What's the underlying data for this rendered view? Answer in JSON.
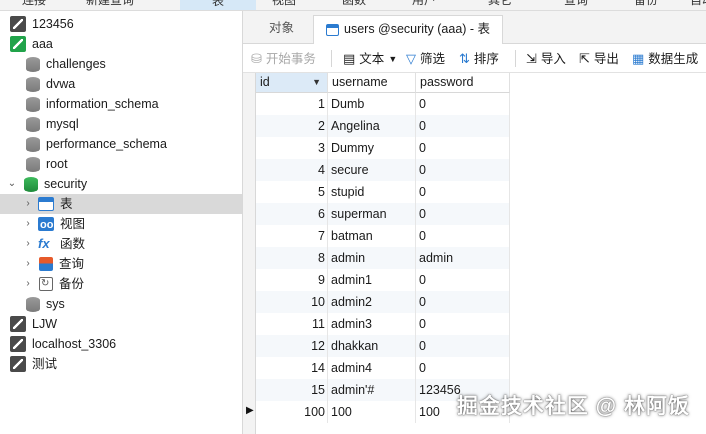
{
  "menu": {
    "items": [
      "连接",
      "新建查询",
      "表",
      "视图",
      "函数",
      "用户",
      "其它",
      "查询",
      "备份",
      "自动"
    ]
  },
  "sidebar": {
    "nodes": [
      {
        "label": "123456",
        "kind": "connection"
      },
      {
        "label": "aaa",
        "kind": "connection-open"
      },
      {
        "label": "challenges",
        "kind": "database"
      },
      {
        "label": "dvwa",
        "kind": "database"
      },
      {
        "label": "information_schema",
        "kind": "database"
      },
      {
        "label": "mysql",
        "kind": "database"
      },
      {
        "label": "performance_schema",
        "kind": "database"
      },
      {
        "label": "root",
        "kind": "database"
      },
      {
        "label": "security",
        "kind": "database-open"
      },
      {
        "label": "表",
        "kind": "tables"
      },
      {
        "label": "视图",
        "kind": "views"
      },
      {
        "label": "函数",
        "kind": "functions"
      },
      {
        "label": "查询",
        "kind": "queries"
      },
      {
        "label": "备份",
        "kind": "backups"
      },
      {
        "label": "sys",
        "kind": "database"
      },
      {
        "label": "LJW",
        "kind": "connection"
      },
      {
        "label": "localhost_3306",
        "kind": "connection"
      },
      {
        "label": "测试",
        "kind": "connection"
      }
    ]
  },
  "tabs": {
    "objects": "对象",
    "active": "users @security (aaa) - 表"
  },
  "toolbar": {
    "begin_transaction": "开始事务",
    "text": "文本",
    "filter": "筛选",
    "sort": "排序",
    "import": "导入",
    "export": "导出",
    "data_gen": "数据生成"
  },
  "grid": {
    "columns": [
      "id",
      "username",
      "password"
    ],
    "rows": [
      [
        "1",
        "Dumb",
        "0"
      ],
      [
        "2",
        "Angelina",
        "0"
      ],
      [
        "3",
        "Dummy",
        "0"
      ],
      [
        "4",
        "secure",
        "0"
      ],
      [
        "5",
        "stupid",
        "0"
      ],
      [
        "6",
        "superman",
        "0"
      ],
      [
        "7",
        "batman",
        "0"
      ],
      [
        "8",
        "admin",
        "admin"
      ],
      [
        "9",
        "admin1",
        "0"
      ],
      [
        "10",
        "admin2",
        "0"
      ],
      [
        "11",
        "admin3",
        "0"
      ],
      [
        "12",
        "dhakkan",
        "0"
      ],
      [
        "14",
        "admin4",
        "0"
      ],
      [
        "15",
        "admin'#",
        "123456"
      ],
      [
        "100",
        "100",
        "100"
      ]
    ]
  },
  "watermark": "掘金技术社区 @ 林阿饭",
  "colors": {
    "accent": "#2b7bd0",
    "connected": "#21a34a",
    "selected_row": "#d9d9d9",
    "header_active": "#dceaf7"
  }
}
